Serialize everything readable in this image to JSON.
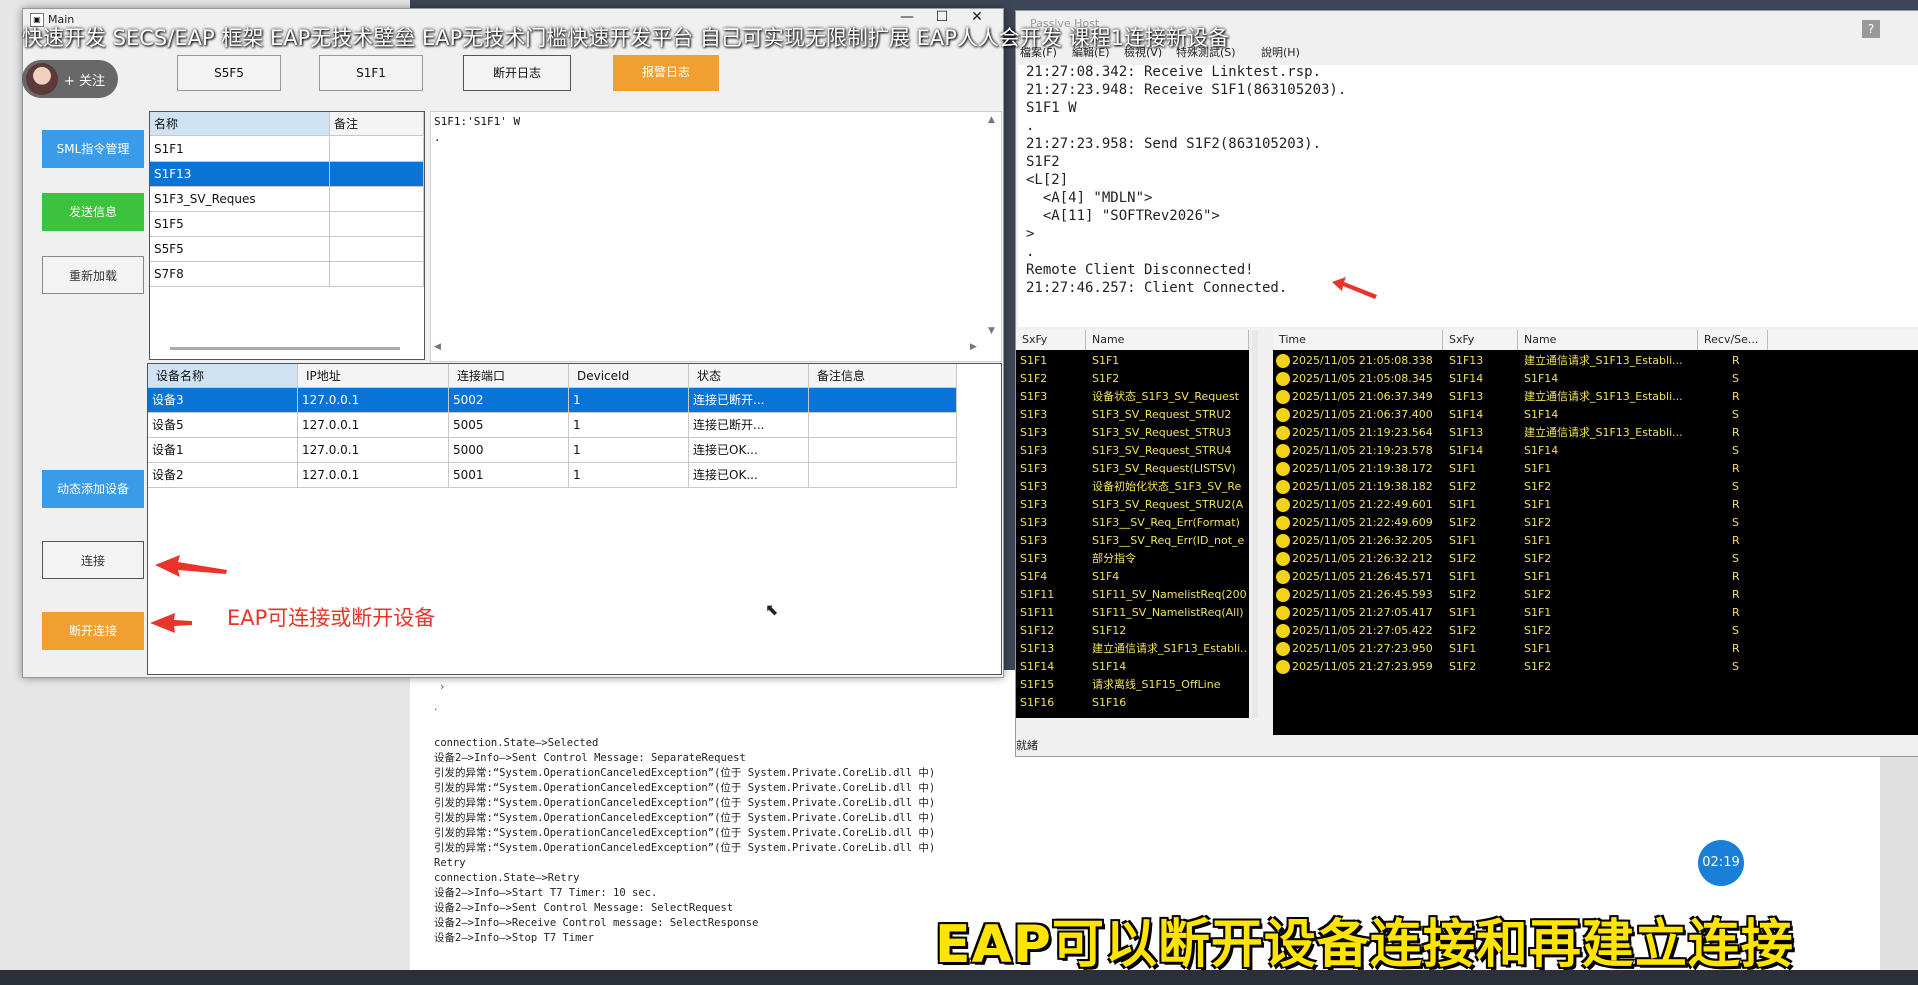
{
  "overlay": {
    "video_title": "快速开发 SECS/EAP 框架 EAP无技术壁垒 EAP无技术门槛快速开发平台 自己可实现无限制扩展 EAP人人会开发 课程1连接新设备",
    "follow_label": "+ 关注",
    "annotation": "EAP可连接或断开设备",
    "caption": "EAP可以断开设备连接和再建立连接",
    "timer": "02:19"
  },
  "main_window": {
    "title": "Main",
    "top_buttons": [
      "S5F5",
      "S1F1",
      "断开日志",
      "报警日志"
    ],
    "side_buttons": [
      "SML指令管理",
      "发送信息",
      "重新加载",
      "动态添加设备",
      "连接",
      "断开连接"
    ],
    "sml_table": {
      "headers": [
        "名称",
        "备注"
      ],
      "rows": [
        {
          "name": "S1F1",
          "note": ""
        },
        {
          "name": "S1F13",
          "note": ""
        },
        {
          "name": "S1F3_SV_Reques",
          "note": ""
        },
        {
          "name": "S1F5",
          "note": ""
        },
        {
          "name": "S5F5",
          "note": ""
        },
        {
          "name": "S7F8",
          "note": ""
        }
      ]
    },
    "sml_text": [
      "S1F1:'S1F1' W",
      "."
    ],
    "device_table": {
      "headers": [
        "设备名称",
        "IP地址",
        "连接端口",
        "DeviceId",
        "状态",
        "备注信息"
      ],
      "rows": [
        {
          "name": "设备3",
          "ip": "127.0.0.1",
          "port": "5002",
          "id": "1",
          "status": "连接已断开...",
          "note": ""
        },
        {
          "name": "设备5",
          "ip": "127.0.0.1",
          "port": "5005",
          "id": "1",
          "status": "连接已断开...",
          "note": ""
        },
        {
          "name": "设备1",
          "ip": "127.0.0.1",
          "port": "5000",
          "id": "1",
          "status": "连接已OK...",
          "note": ""
        },
        {
          "name": "设备2",
          "ip": "127.0.0.1",
          "port": "5001",
          "id": "1",
          "status": "连接已OK...",
          "note": ""
        }
      ]
    }
  },
  "output_log": [
    "connection.State—>Selected",
    "设备2—>Info—>Sent Control Message: SeparateRequest",
    "引发的异常:“System.OperationCanceledException”(位于 System.Private.CoreLib.dll 中)",
    "引发的异常:“System.OperationCanceledException”(位于 System.Private.CoreLib.dll 中)",
    "引发的异常:“System.OperationCanceledException”(位于 System.Private.CoreLib.dll 中)",
    "引发的异常:“System.OperationCanceledException”(位于 System.Private.CoreLib.dll 中)",
    "引发的异常:“System.OperationCanceledException”(位于 System.Private.CoreLib.dll 中)",
    "引发的异常:“System.OperationCanceledException”(位于 System.Private.CoreLib.dll 中)",
    "Retry",
    "connection.State—>Retry",
    "设备2—>Info—>Start T7 Timer: 10 sec.",
    "设备2—>Info—>Sent Control Message: SelectRequest",
    "设备2—>Info—>Receive Control message: SelectResponse",
    "设备2—>Info—>Stop T7 Timer"
  ],
  "right_window": {
    "title": "Passive Host",
    "menu": [
      "檔案(F)",
      "編輯(E)",
      "檢視(V)",
      "特殊測試(S)",
      "說明(H)"
    ],
    "log": [
      "21:27:08.342: Receive Linktest.rsp.",
      "21:27:23.948: Receive S1F1(863105203).",
      "S1F1 W",
      ".",
      "21:27:23.958: Send S1F2(863105203).",
      "S1F2",
      "<L[2]",
      "  <A[4] \"MDLN\">",
      "  <A[11] \"SOFTRev2026\">",
      ">",
      ".",
      "Remote Client Disconnected!",
      "21:27:46.257: Client Connected."
    ],
    "left_headers": [
      "SxFy",
      "Name"
    ],
    "left_rows": [
      [
        "S1F1",
        "S1F1"
      ],
      [
        "S1F2",
        "S1F2"
      ],
      [
        "S1F3",
        "设备状态_S1F3_SV_Request"
      ],
      [
        "S1F3",
        "S1F3_SV_Request_STRU2"
      ],
      [
        "S1F3",
        "S1F3_SV_Request_STRU3"
      ],
      [
        "S1F3",
        "S1F3_SV_Request_STRU4"
      ],
      [
        "S1F3",
        "S1F3_SV_Request(LISTSV)"
      ],
      [
        "S1F3",
        "设备初始化状态_S1F3_SV_Re"
      ],
      [
        "S1F3",
        "S1F3_SV_Request_STRU2(A"
      ],
      [
        "S1F3",
        "S1F3__SV_Req_Err(Format)"
      ],
      [
        "S1F3",
        "S1F3__SV_Req_Err(ID_not_e"
      ],
      [
        "S1F3",
        "部分指令"
      ],
      [
        "S1F4",
        "S1F4"
      ],
      [
        "S1F11",
        "S1F11_SV_NamelistReq(200"
      ],
      [
        "S1F11",
        "S1F11_SV_NamelistReq(All)"
      ],
      [
        "S1F12",
        "S1F12"
      ],
      [
        "S1F13",
        "建立通信请求_S1F13_Establi..."
      ],
      [
        "S1F14",
        "S1F14"
      ],
      [
        "S1F15",
        "请求离线_S1F15_OffLine"
      ],
      [
        "S1F16",
        "S1F16"
      ]
    ],
    "right_headers": [
      "Time",
      "SxFy",
      "Name",
      "Recv/Se..."
    ],
    "right_rows": [
      [
        "2025/11/05 21:05:08.338",
        "S1F13",
        "建立通信请求_S1F13_Establi...",
        "R"
      ],
      [
        "2025/11/05 21:05:08.345",
        "S1F14",
        "S1F14",
        "S"
      ],
      [
        "2025/11/05 21:06:37.349",
        "S1F13",
        "建立通信请求_S1F13_Establi...",
        "R"
      ],
      [
        "2025/11/05 21:06:37.400",
        "S1F14",
        "S1F14",
        "S"
      ],
      [
        "2025/11/05 21:19:23.564",
        "S1F13",
        "建立通信请求_S1F13_Establi...",
        "R"
      ],
      [
        "2025/11/05 21:19:23.578",
        "S1F14",
        "S1F14",
        "S"
      ],
      [
        "2025/11/05 21:19:38.172",
        "S1F1",
        "S1F1",
        "R"
      ],
      [
        "2025/11/05 21:19:38.182",
        "S1F2",
        "S1F2",
        "S"
      ],
      [
        "2025/11/05 21:22:49.601",
        "S1F1",
        "S1F1",
        "R"
      ],
      [
        "2025/11/05 21:22:49.609",
        "S1F2",
        "S1F2",
        "S"
      ],
      [
        "2025/11/05 21:26:32.205",
        "S1F1",
        "S1F1",
        "R"
      ],
      [
        "2025/11/05 21:26:32.212",
        "S1F2",
        "S1F2",
        "S"
      ],
      [
        "2025/11/05 21:26:45.571",
        "S1F1",
        "S1F1",
        "R"
      ],
      [
        "2025/11/05 21:26:45.593",
        "S1F2",
        "S1F2",
        "R"
      ],
      [
        "2025/11/05 21:27:05.417",
        "S1F1",
        "S1F1",
        "R"
      ],
      [
        "2025/11/05 21:27:05.422",
        "S1F2",
        "S1F2",
        "S"
      ],
      [
        "2025/11/05 21:27:23.950",
        "S1F1",
        "S1F1",
        "R"
      ],
      [
        "2025/11/05 21:27:23.959",
        "S1F2",
        "S1F2",
        "S"
      ]
    ],
    "status": "就緒"
  },
  "colors": {
    "selection": "#0a74d6",
    "sml_btn": "#3a9be8",
    "send_btn": "#3cc23c",
    "add_btn": "#3a9be8",
    "disconnect_btn": "#f0a030",
    "alarm_btn": "#f0a030",
    "annotation": "#e8342a"
  }
}
